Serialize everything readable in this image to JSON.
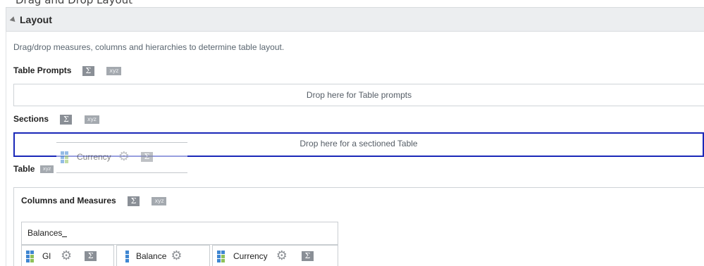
{
  "top_fragment": "Drag and Drop Layout",
  "header": {
    "title": "Layout",
    "collapse_icon": "collapse-triangle-icon"
  },
  "instructions": "Drag/drop measures, columns and hierarchies to determine table layout.",
  "table_prompts": {
    "label": "Table Prompts",
    "drop_text": "Drop here for Table prompts"
  },
  "sections": {
    "label": "Sections",
    "drop_text": "Drop here for a sectioned Table"
  },
  "drag_item": {
    "label": "Currency"
  },
  "table": {
    "label": "Table"
  },
  "columns_measures": {
    "label": "Columns and Measures"
  },
  "balances": {
    "label": "Balances"
  },
  "columns": [
    {
      "label": "Gl",
      "type": "hierarchy"
    },
    {
      "label": "Balance",
      "type": "measure"
    },
    {
      "label": "Currency",
      "type": "hierarchy"
    }
  ],
  "icons": {
    "sigma": "Σ",
    "xyz": "xyz",
    "gear": "⚙"
  },
  "colors": {
    "active_drop_border": "#1a28b8",
    "header_bg": "#eceef0",
    "hierarchy_blue": "#3f86d1",
    "hierarchy_green": "#8fc15a"
  }
}
